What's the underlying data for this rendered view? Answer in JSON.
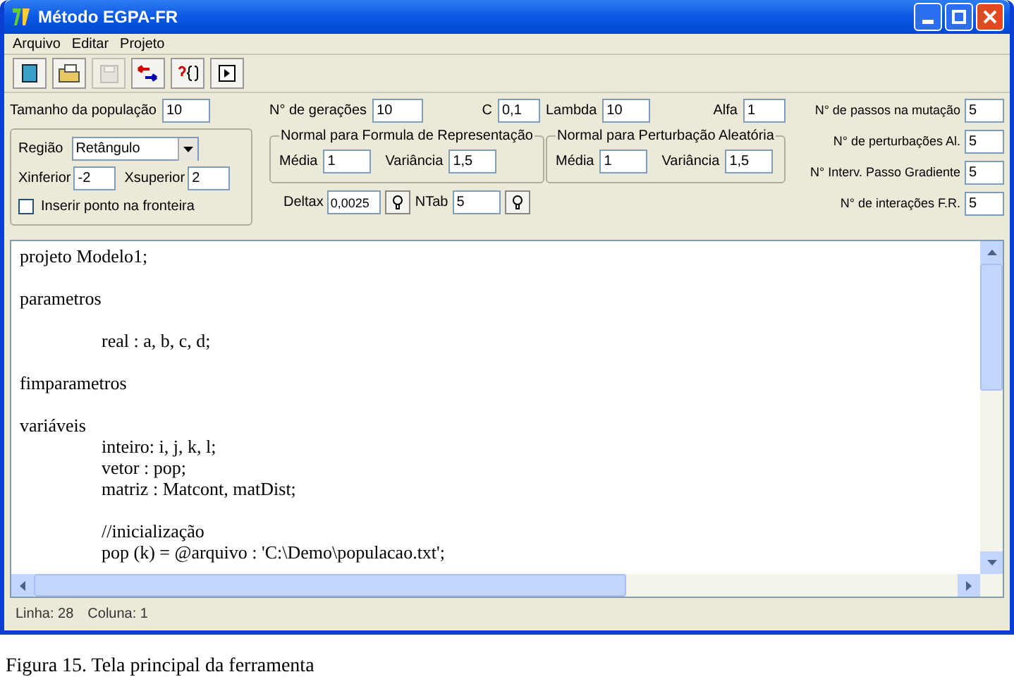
{
  "window": {
    "title": "Método EGPA-FR"
  },
  "menu": [
    "Arquivo",
    "Editar",
    "Projeto"
  ],
  "toolbar": [
    {
      "kind": "new",
      "disabled": false
    },
    {
      "kind": "open",
      "disabled": false
    },
    {
      "kind": "save",
      "disabled": true
    },
    {
      "kind": "swap",
      "disabled": false
    },
    {
      "kind": "help",
      "disabled": false
    },
    {
      "kind": "run",
      "disabled": false
    }
  ],
  "population": {
    "label": "Tamanho da população",
    "value": "10"
  },
  "region": {
    "label": "Região",
    "value": "Retângulo",
    "xinf_label": "Xinferior",
    "xinf": "-2",
    "xsup_label": "Xsuperior",
    "xsup": "2",
    "checkbox": {
      "label": "Inserir ponto na fronteira",
      "checked": false
    }
  },
  "generations": {
    "label": "N° de gerações",
    "value": "10"
  },
  "c": {
    "label": "C",
    "value": "0,1"
  },
  "lambda": {
    "label": "Lambda",
    "value": "10"
  },
  "alfa": {
    "label": "Alfa",
    "value": "1"
  },
  "group_representation": {
    "title": "Normal para Formula de Representação",
    "mean_label": "Média",
    "mean": "1",
    "var_label": "Variância",
    "var": "1,5"
  },
  "group_perturbation": {
    "title": "Normal para Perturbação Aleatória",
    "mean_label": "Média",
    "mean": "1",
    "var_label": "Variância",
    "var": "1,5"
  },
  "deltax": {
    "label": "Deltax",
    "value": "0,0025"
  },
  "ntab": {
    "label": "NTab",
    "value": "5"
  },
  "right_fields": [
    {
      "label": "N° de passos na mutação",
      "value": "5"
    },
    {
      "label": "N° de perturbações Al.",
      "value": "5"
    },
    {
      "label": "N° Interv. Passo Gradiente",
      "value": "5"
    },
    {
      "label": "N° de interações F.R.",
      "value": "5"
    }
  ],
  "editor": {
    "lines": [
      {
        "kind": "text",
        "text": "projeto Modelo1;"
      },
      {
        "kind": "blank"
      },
      {
        "kind": "text",
        "text": "parametros",
        "children": [
          {
            "kind": "blank"
          },
          {
            "kind": "text",
            "text": "real : a, b, c, d;"
          },
          {
            "kind": "blank"
          }
        ]
      },
      {
        "kind": "text",
        "text": "fimparametros"
      },
      {
        "kind": "blank"
      },
      {
        "kind": "text",
        "text": "variáveis",
        "children": [
          {
            "kind": "text",
            "text": "inteiro: i, j, k, l;"
          },
          {
            "kind": "text",
            "text": "vetor : pop;"
          },
          {
            "kind": "text",
            "text": "matriz : Matcont, matDist;"
          },
          {
            "kind": "blank"
          },
          {
            "kind": "text",
            "text": "//inicialização"
          },
          {
            "kind": "text",
            "text": "pop (k) = @arquivo : 'C:\\Demo\\populacao.txt';"
          }
        ]
      }
    ]
  },
  "status_bar": [
    "Linha: 28",
    "Coluna: 1"
  ],
  "caption": "Figura 15. Tela principal da ferramenta"
}
